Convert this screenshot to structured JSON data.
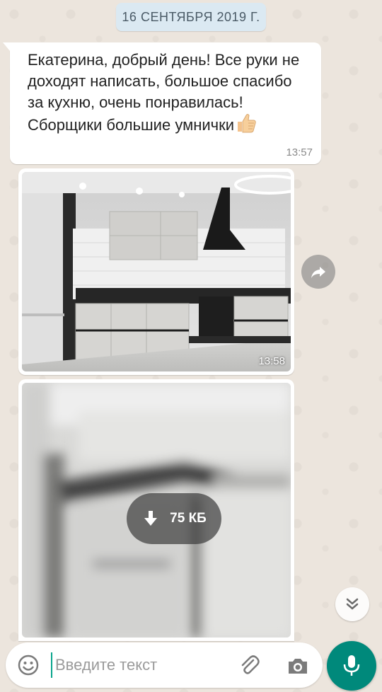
{
  "chat": {
    "date_chip": "16 СЕНТЯБРЯ 2019 Г.",
    "messages": [
      {
        "type": "text",
        "text": "Екатерина, добрый день! Все руки не доходят написать, большое спасибо за кухню, очень понравилась! Сборщики большие умнички",
        "emoji": "thumbs-up",
        "time": "13:57"
      },
      {
        "type": "image",
        "time": "13:58"
      },
      {
        "type": "image",
        "download_size": "75 КБ"
      }
    ]
  },
  "input_bar": {
    "placeholder": "Введите текст"
  },
  "icons": {
    "emoji": "emoji-icon",
    "attach": "paperclip-icon",
    "camera": "camera-icon",
    "mic": "microphone-icon",
    "forward": "forward-icon",
    "download": "download-icon",
    "scroll": "chevron-double-down-icon"
  },
  "colors": {
    "accent": "#00897b",
    "wallpaper": "#ece5dd",
    "date_chip": "#dbe9f2"
  }
}
